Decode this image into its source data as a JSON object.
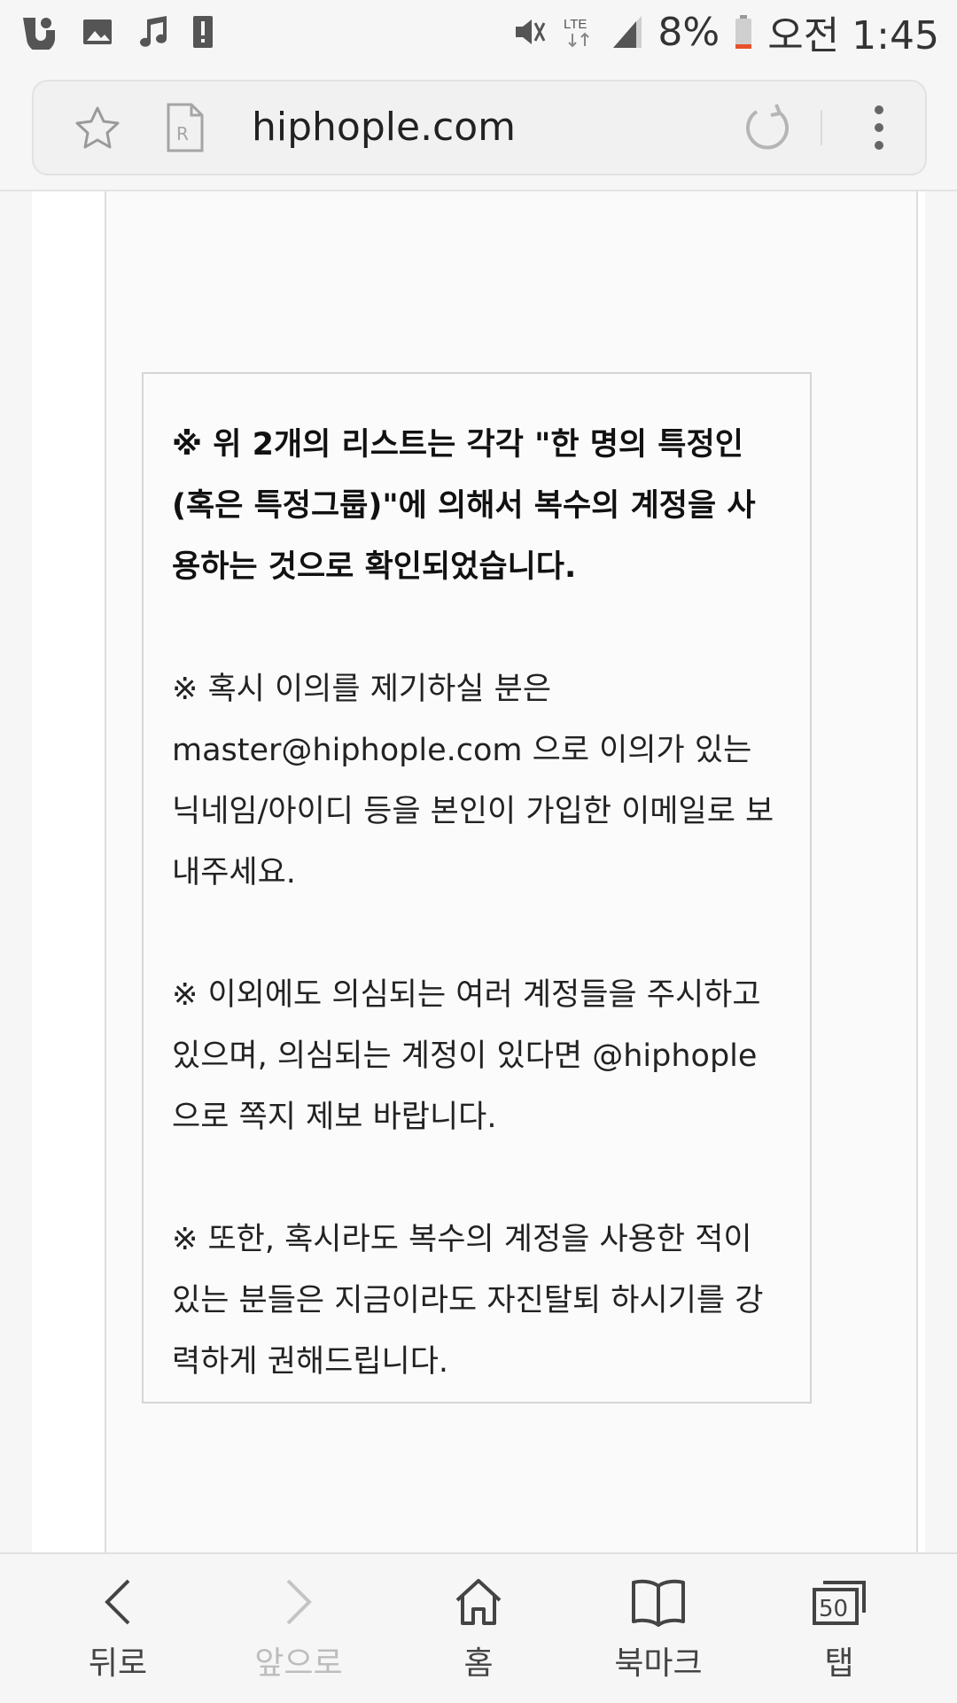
{
  "status_bar": {
    "battery": "8%",
    "time": "오전 1:45",
    "network": "LTE",
    "icons_left": [
      "app-icon",
      "image-icon",
      "music-icon",
      "alert-icon"
    ],
    "icons_right": [
      "mute-icon",
      "lte-icon",
      "signal-icon",
      "battery-icon"
    ],
    "battery_color": "#e8512a"
  },
  "browser": {
    "url": "hiphople.com",
    "reader_label": "R"
  },
  "notice": {
    "paragraphs": [
      "※ 위 2개의 리스트는 각각 \"한 명의 특정인(혹은 특정그룹)\"에 의해서 복수의 계정을 사용하는 것으로 확인되었습니다.",
      "※ 혹시 이의를 제기하실 분은 master@hiphople.com 으로 이의가 있는 닉네임/아이디 등을 본인이 가입한 이메일로 보내주세요.",
      "※ 이외에도 의심되는 여러 계정들을 주시하고 있으며, 의심되는 계정이 있다면 @hiphople 으로 쪽지 제보 바랍니다.",
      "※ 또한, 혹시라도 복수의 계정을 사용한 적이 있는 분들은 지금이라도 자진탈퇴 하시기를 강력하게 권해드립니다."
    ]
  },
  "bottom_nav": {
    "back": "뒤로",
    "forward": "앞으로",
    "home": "홈",
    "bookmarks": "북마크",
    "tabs": "탭",
    "tab_count": "50"
  }
}
